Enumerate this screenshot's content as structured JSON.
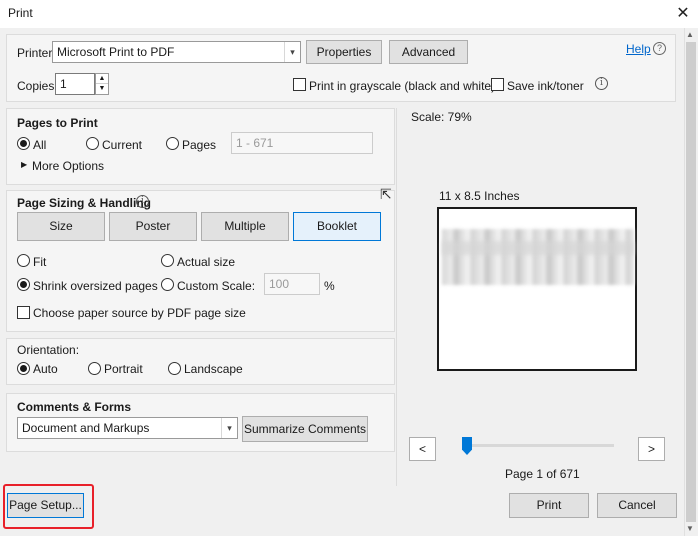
{
  "window": {
    "title": "Print"
  },
  "printer": {
    "label": "Printer:",
    "selected": "Microsoft Print to PDF",
    "properties_label": "Properties",
    "advanced_label": "Advanced",
    "help_label": "Help"
  },
  "copies": {
    "label": "Copies:",
    "value": "1",
    "grayscale_label": "Print in grayscale (black and white)",
    "grayscale_checked": false,
    "save_ink_label": "Save ink/toner",
    "save_ink_checked": false
  },
  "pages_to_print": {
    "heading": "Pages to Print",
    "options": [
      "All",
      "Current",
      "Pages"
    ],
    "selected": "All",
    "pages_placeholder": "1 - 671",
    "more_options_label": "More Options"
  },
  "page_sizing": {
    "heading": "Page Sizing & Handling",
    "tabs": [
      "Size",
      "Poster",
      "Multiple",
      "Booklet"
    ],
    "active_tab": "Booklet",
    "fit_label": "Fit",
    "actual_size_label": "Actual size",
    "shrink_label": "Shrink oversized pages",
    "custom_scale_label": "Custom Scale:",
    "custom_scale_value": "100",
    "percent_label": "%",
    "paper_source_label": "Choose paper source by PDF page size",
    "selected": "Shrink oversized pages"
  },
  "orientation": {
    "heading": "Orientation:",
    "options": [
      "Auto",
      "Portrait",
      "Landscape"
    ],
    "selected": "Auto"
  },
  "comments_forms": {
    "heading": "Comments & Forms",
    "selected": "Document and Markups",
    "summarize_label": "Summarize Comments"
  },
  "preview": {
    "scale_text": "Scale:  79%",
    "paper_size_text": "11 x 8.5 Inches",
    "page_info": "Page 1 of 671",
    "prev_label": "<",
    "next_label": ">",
    "slider_fraction": 0
  },
  "footer": {
    "page_setup_label": "Page Setup...",
    "print_label": "Print",
    "cancel_label": "Cancel"
  },
  "colors": {
    "accent": "#0078d7",
    "highlight_box": "#e8202a",
    "link": "#0066cc"
  }
}
